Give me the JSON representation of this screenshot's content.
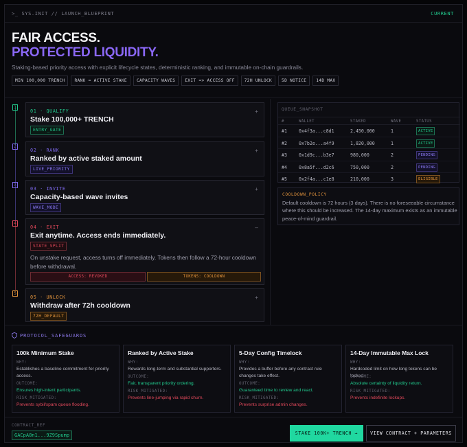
{
  "topbar": {
    "path": ">_ SYS.INIT // LAUNCH_BLUEPRINT",
    "badge": "CURRENT"
  },
  "hero": {
    "title_line1": "FAIR ACCESS.",
    "title_line2": "PROTECTED LIQUIDITY.",
    "subtitle": "Staking-based priority access with explicit lifecycle states, deterministic ranking, and immutable on-chain guardrails.",
    "chips": [
      "MIN 100,000 TRENCH",
      "RANK = ACTIVE STAKE",
      "CAPACITY WAVES",
      "EXIT => ACCESS OFF",
      "72H UNLOCK",
      "5D NOTICE",
      "14D MAX"
    ]
  },
  "steps": [
    {
      "num": "1",
      "index": "01 · QUALIFY",
      "title": "Stake 100,000+ TRENCH",
      "tag": "ENTRY_GATE",
      "toggle": "+"
    },
    {
      "num": "2",
      "index": "02 · RANK",
      "title": "Ranked by active staked amount",
      "tag": "LIVE_PRIORITY",
      "toggle": "+"
    },
    {
      "num": "3",
      "index": "03 · INVITE",
      "title": "Capacity-based wave invites",
      "tag": "WAVE_MODE",
      "toggle": "+"
    },
    {
      "num": "4",
      "index": "04 · EXIT",
      "title": "Exit anytime. Access ends immediately.",
      "tag": "STATE_SPLIT",
      "toggle": "–",
      "details": "On unstake request, access turns off immediately. Tokens then follow a 72-hour cooldown before withdrawal.",
      "pill_access": "ACCESS: REVOKED",
      "pill_tokens": "TOKENS: COOLDOWN"
    },
    {
      "num": "5",
      "index": "05 · UNLOCK",
      "title": "Withdraw after 72h cooldown",
      "tag": "72H_DEFAULT",
      "toggle": "+"
    }
  ],
  "queue": {
    "title": "QUEUE_SNAPSHOT",
    "columns": [
      "#",
      "WALLET",
      "STAKED",
      "WAVE",
      "STATUS"
    ],
    "rows": [
      {
        "rank": "#1",
        "wallet": "0x4f3a...c8d1",
        "staked": "2,450,000",
        "wave": "1",
        "status": "ACTIVE"
      },
      {
        "rank": "#2",
        "wallet": "0x7b2e...a4f9",
        "staked": "1,820,000",
        "wave": "1",
        "status": "ACTIVE"
      },
      {
        "rank": "#3",
        "wallet": "0x1d9c...b3e7",
        "staked": "980,000",
        "wave": "2",
        "status": "PENDING"
      },
      {
        "rank": "#4",
        "wallet": "0x8a5f...d2c6",
        "staked": "750,000",
        "wave": "2",
        "status": "PENDING"
      },
      {
        "rank": "#5",
        "wallet": "0x2f4a...c1e8",
        "staked": "210,000",
        "wave": "3",
        "status": "ELIGIBLE"
      }
    ]
  },
  "cooldown": {
    "title": "COOLDOWN_POLICY",
    "body": "Default cooldown is 72 hours (3 days). There is no foreseeable circumstance where this should be increased. The 14-day maximum exists as an immutable peace-of-mind guardrail."
  },
  "safeguards": {
    "title": "PROTOCOL_SAFEGUARDS",
    "labels": {
      "why": "WHY:",
      "outcome": "OUTCOME:",
      "risk": "RISK_MITIGATED:"
    },
    "cards": [
      {
        "title": "100k Minimum Stake",
        "why": "Establishes a baseline commitment for priority access.",
        "outcome": "Ensures high-intent participants.",
        "risk": "Prevents sybil/spam queue flooding."
      },
      {
        "title": "Ranked by Active Stake",
        "why": "Rewards long-term and substantial supporters.",
        "outcome": "Fair, transparent priority ordering.",
        "risk": "Prevents line-jumping via rapid churn."
      },
      {
        "title": "5-Day Config Timelock",
        "why": "Provides a buffer before any contract rule changes take effect.",
        "outcome": "Guaranteed time to review and react.",
        "risk": "Prevents surprise admin changes."
      },
      {
        "title": "14-Day Immutable Max Lock",
        "why": "Hardcoded limit on how long tokens can be locked.",
        "outcome": "Absolute certainty of liquidity return.",
        "risk": "Prevents indefinite lockups."
      }
    ]
  },
  "footer": {
    "contract_label": "CONTRACT_REF",
    "contract_address": "GACpA8n1...9Z9Spump",
    "primary_button": "STAKE 100K+ TRENCH →",
    "secondary_button": "VIEW CONTRACT + PARAMETERS"
  },
  "colors": {
    "accent_green": "#21c98d",
    "accent_purple": "#8a67f6",
    "accent_orange": "#e0923c",
    "accent_red": "#e0485a"
  }
}
